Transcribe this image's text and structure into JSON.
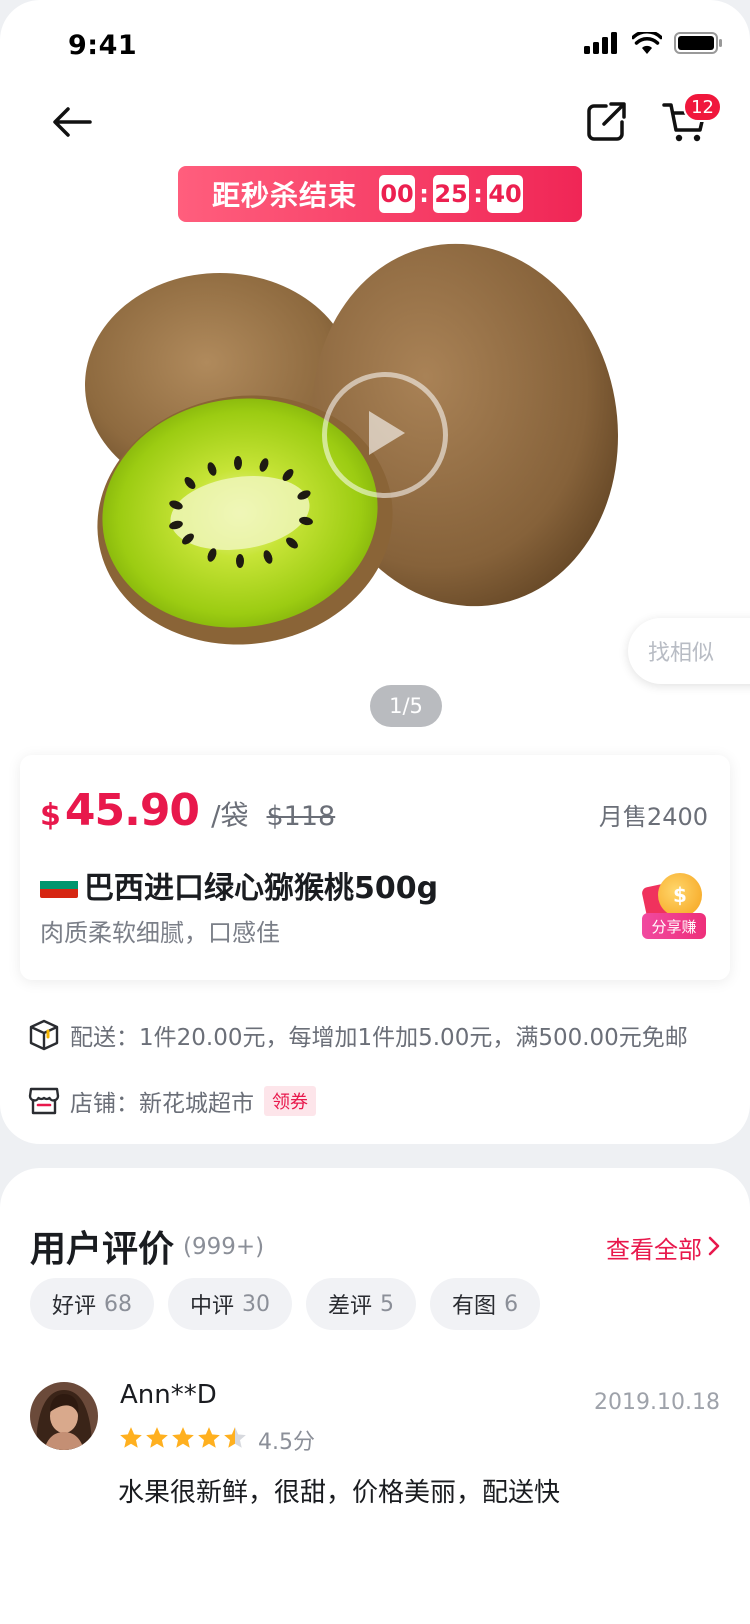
{
  "status_bar": {
    "time": "9:41"
  },
  "nav": {
    "cart_count": "12"
  },
  "flash_sale": {
    "label": "距秒杀结束",
    "hours": "00",
    "minutes": "25",
    "seconds": "40",
    "separator": ":"
  },
  "gallery": {
    "find_similar": "找相似",
    "pager": "1/5"
  },
  "product": {
    "currency_symbol": "$",
    "price": "45.90",
    "unit": "/袋",
    "original_price": "$118",
    "monthly_sales": "月售2400",
    "title": "巴西进口绿心猕猴桃500g",
    "subtitle": "肉质柔软细腻，口感佳",
    "share_earn": "分享赚",
    "share_coin": "$"
  },
  "info": {
    "delivery": "配送：1件20.00元，每增加1件加5.00元，满500.00元免邮",
    "store": "店铺：新花城超市",
    "coupon": "领券"
  },
  "reviews": {
    "title": "用户评价",
    "count": "(999+)",
    "view_all": "查看全部",
    "tags": [
      {
        "label": "好评",
        "count": "68"
      },
      {
        "label": "中评",
        "count": "30"
      },
      {
        "label": "差评",
        "count": "5"
      },
      {
        "label": "有图",
        "count": "6"
      }
    ],
    "items": [
      {
        "user": "Ann**D",
        "date": "2019.10.18",
        "rating": 4.5,
        "score": "4.5分",
        "text": "水果很新鲜，很甜，价格美丽，配送快"
      }
    ]
  },
  "colors": {
    "accent": "#e8184c",
    "star": "#ffb01f"
  }
}
